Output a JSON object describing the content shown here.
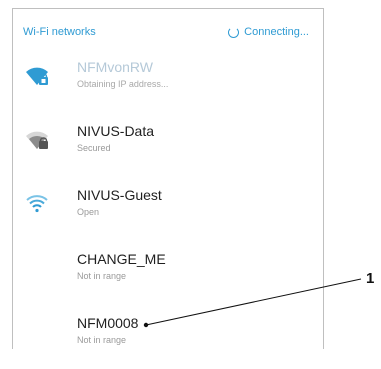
{
  "header": {
    "title": "Wi-Fi networks",
    "status": "Connecting...",
    "accent_color": "#2f9bd3"
  },
  "networks": [
    {
      "name": "NFMvonRW",
      "status": "Obtaining IP address...",
      "icon": "wifi-locked-icon",
      "faded": true
    },
    {
      "name": "NIVUS-Data",
      "status": "Secured",
      "icon": "wifi-locked-icon",
      "faded": false
    },
    {
      "name": "NIVUS-Guest",
      "status": "Open",
      "icon": "wifi-open-icon",
      "faded": false
    },
    {
      "name": "CHANGE_ME",
      "status": "Not in range",
      "icon": "",
      "faded": false
    },
    {
      "name": "NFM0008",
      "status": "Not in range",
      "icon": "",
      "faded": false
    }
  ],
  "callout": {
    "number": "1"
  }
}
